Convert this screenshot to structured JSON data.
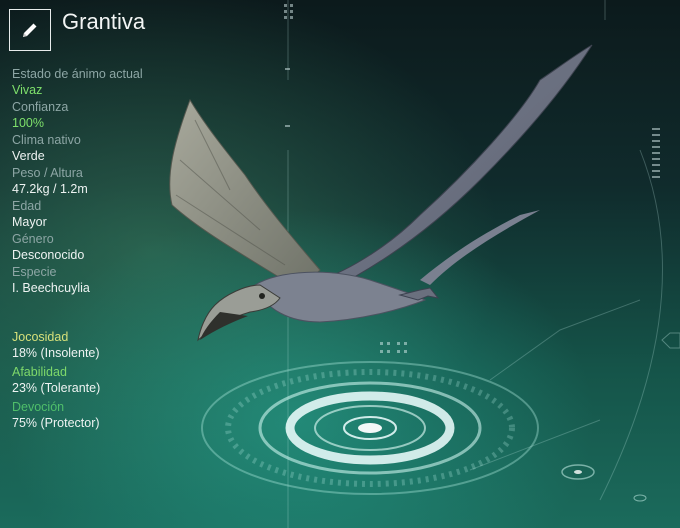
{
  "creature": {
    "name": "Grantiva"
  },
  "stats": [
    {
      "label": "Estado de ánimo actual",
      "value": "Vivaz",
      "highlight": true
    },
    {
      "label": "Confianza",
      "value": "100%",
      "highlight": true
    },
    {
      "label": "Clima nativo",
      "value": "Verde",
      "highlight": false
    },
    {
      "label": "Peso / Altura",
      "value": "47.2kg / 1.2m",
      "highlight": false
    },
    {
      "label": "Edad",
      "value": "Mayor",
      "highlight": false
    },
    {
      "label": "Género",
      "value": "Desconocido",
      "highlight": false
    },
    {
      "label": "Especie",
      "value": "I. Beechcuylia",
      "highlight": false
    }
  ],
  "traits": [
    {
      "label": "Jocosidad",
      "value": "18% (Insolente)",
      "color": "#d6e07a"
    },
    {
      "label": "Afabilidad",
      "value": "23% (Tolerante)",
      "color": "#7ed86a"
    },
    {
      "label": "Devoción",
      "value": "75% (Protector)",
      "color": "#4fbf6a"
    }
  ],
  "icons": {
    "edit": "pencil-icon"
  }
}
